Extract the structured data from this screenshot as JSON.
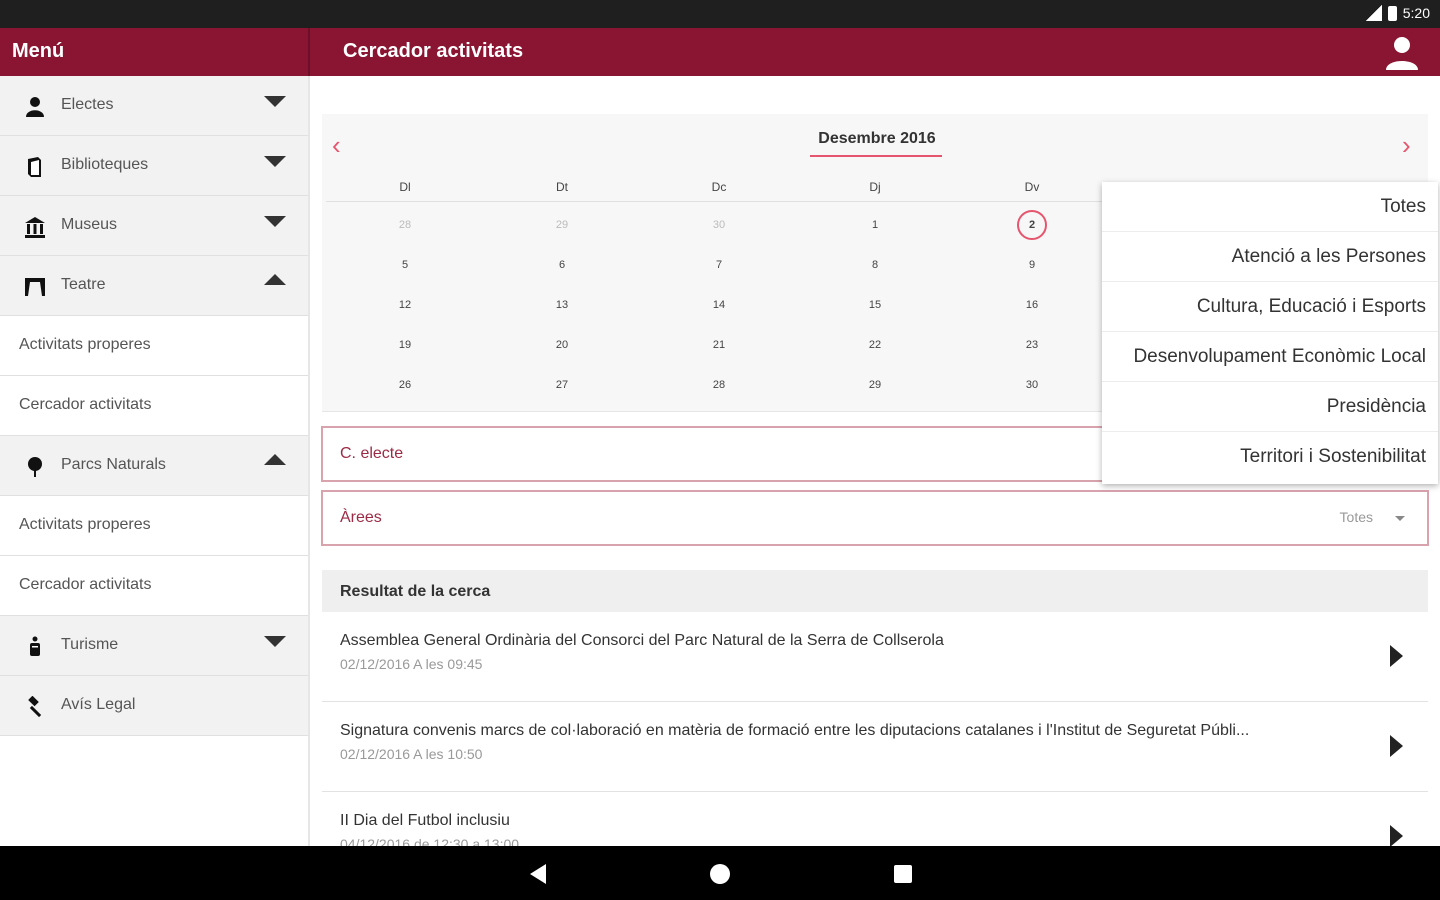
{
  "status": {
    "time": "5:20"
  },
  "appbar": {
    "menu_title": "Menú",
    "page_title": "Cercador activitats"
  },
  "sidebar": {
    "items": [
      {
        "label": "Electes",
        "icon": "person-icon",
        "type": "parent",
        "expanded": false
      },
      {
        "label": "Biblioteques",
        "icon": "book-icon",
        "type": "parent",
        "expanded": false
      },
      {
        "label": "Museus",
        "icon": "museum-icon",
        "type": "parent",
        "expanded": false
      },
      {
        "label": "Teatre",
        "icon": "theater-icon",
        "type": "parent",
        "expanded": true
      },
      {
        "label": "Activitats properes",
        "type": "sub"
      },
      {
        "label": "Cercador activitats",
        "type": "sub"
      },
      {
        "label": "Parcs Naturals",
        "icon": "tree-icon",
        "type": "parent",
        "expanded": true
      },
      {
        "label": "Activitats properes",
        "type": "sub"
      },
      {
        "label": "Cercador activitats",
        "type": "sub"
      },
      {
        "label": "Turisme",
        "icon": "tourist-icon",
        "type": "parent",
        "expanded": false
      },
      {
        "label": "Avís Legal",
        "icon": "gavel-icon",
        "type": "parent",
        "expanded": false
      }
    ]
  },
  "calendar": {
    "month": "Desembre 2016",
    "prev": "‹",
    "next": "›",
    "weekdays": [
      "Dl",
      "Dt",
      "Dc",
      "Dj",
      "Dv"
    ],
    "weeks": [
      [
        "28",
        "29",
        "30",
        "1",
        "2"
      ],
      [
        "5",
        "6",
        "7",
        "8",
        "9"
      ],
      [
        "12",
        "13",
        "14",
        "15",
        "16"
      ],
      [
        "19",
        "20",
        "21",
        "22",
        "23"
      ],
      [
        "26",
        "27",
        "28",
        "29",
        "30"
      ]
    ],
    "out_of_month_first_week": 3,
    "selected_day": "2"
  },
  "filters": {
    "electe_label": "C. electe",
    "areas_label": "Àrees",
    "areas_value": "Totes"
  },
  "results": {
    "header": "Resultat de la cerca",
    "items": [
      {
        "title": "Assemblea General Ordinària del Consorci del Parc Natural de la Serra de Collserola",
        "date": "02/12/2016 A les 09:45"
      },
      {
        "title": "Signatura convenis marcs de col·laboració en matèria de formació entre les diputacions catalanes i l'Institut de Seguretat Públi...",
        "date": "02/12/2016 A les 10:50"
      },
      {
        "title": "II Dia del Futbol inclusiu",
        "date": "04/12/2016 de 12:30 a 13:00"
      }
    ]
  },
  "dropdown": {
    "options": [
      "Totes",
      "Atenció a les Persones",
      "Cultura, Educació i Esports",
      "Desenvolupament Econòmic Local",
      "Presidència",
      "Territori i Sostenibilitat"
    ]
  },
  "colors": {
    "primary": "#8a1532",
    "accent": "#e5566e"
  }
}
